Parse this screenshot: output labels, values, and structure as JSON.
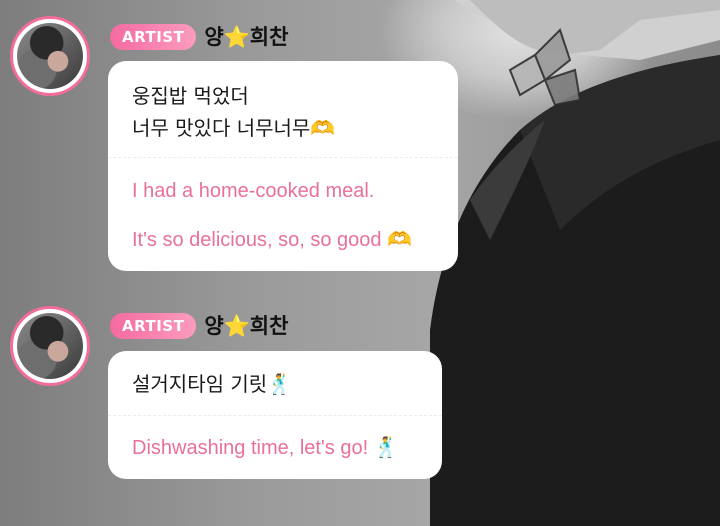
{
  "messages": [
    {
      "badge": "ARTIST",
      "author": "양⭐희찬",
      "original_lines": [
        "웅집밥 먹었더",
        "너무 맛있다 너무너무🫶"
      ],
      "translation_lines": [
        "I had a home-cooked meal.",
        "It's so delicious, so, so good 🫶"
      ]
    },
    {
      "badge": "ARTIST",
      "author": "양⭐희찬",
      "original_lines": [
        "설거지타임 기릿🕺"
      ],
      "translation_lines": [
        "Dishwashing time, let's go! 🕺"
      ]
    }
  ],
  "colors": {
    "badge_start": "#f56aa0",
    "badge_end": "#fb9cbe",
    "avatar_ring": "#f26c9c",
    "translation_text": "#e8709a",
    "bubble_bg": "#ffffff"
  }
}
